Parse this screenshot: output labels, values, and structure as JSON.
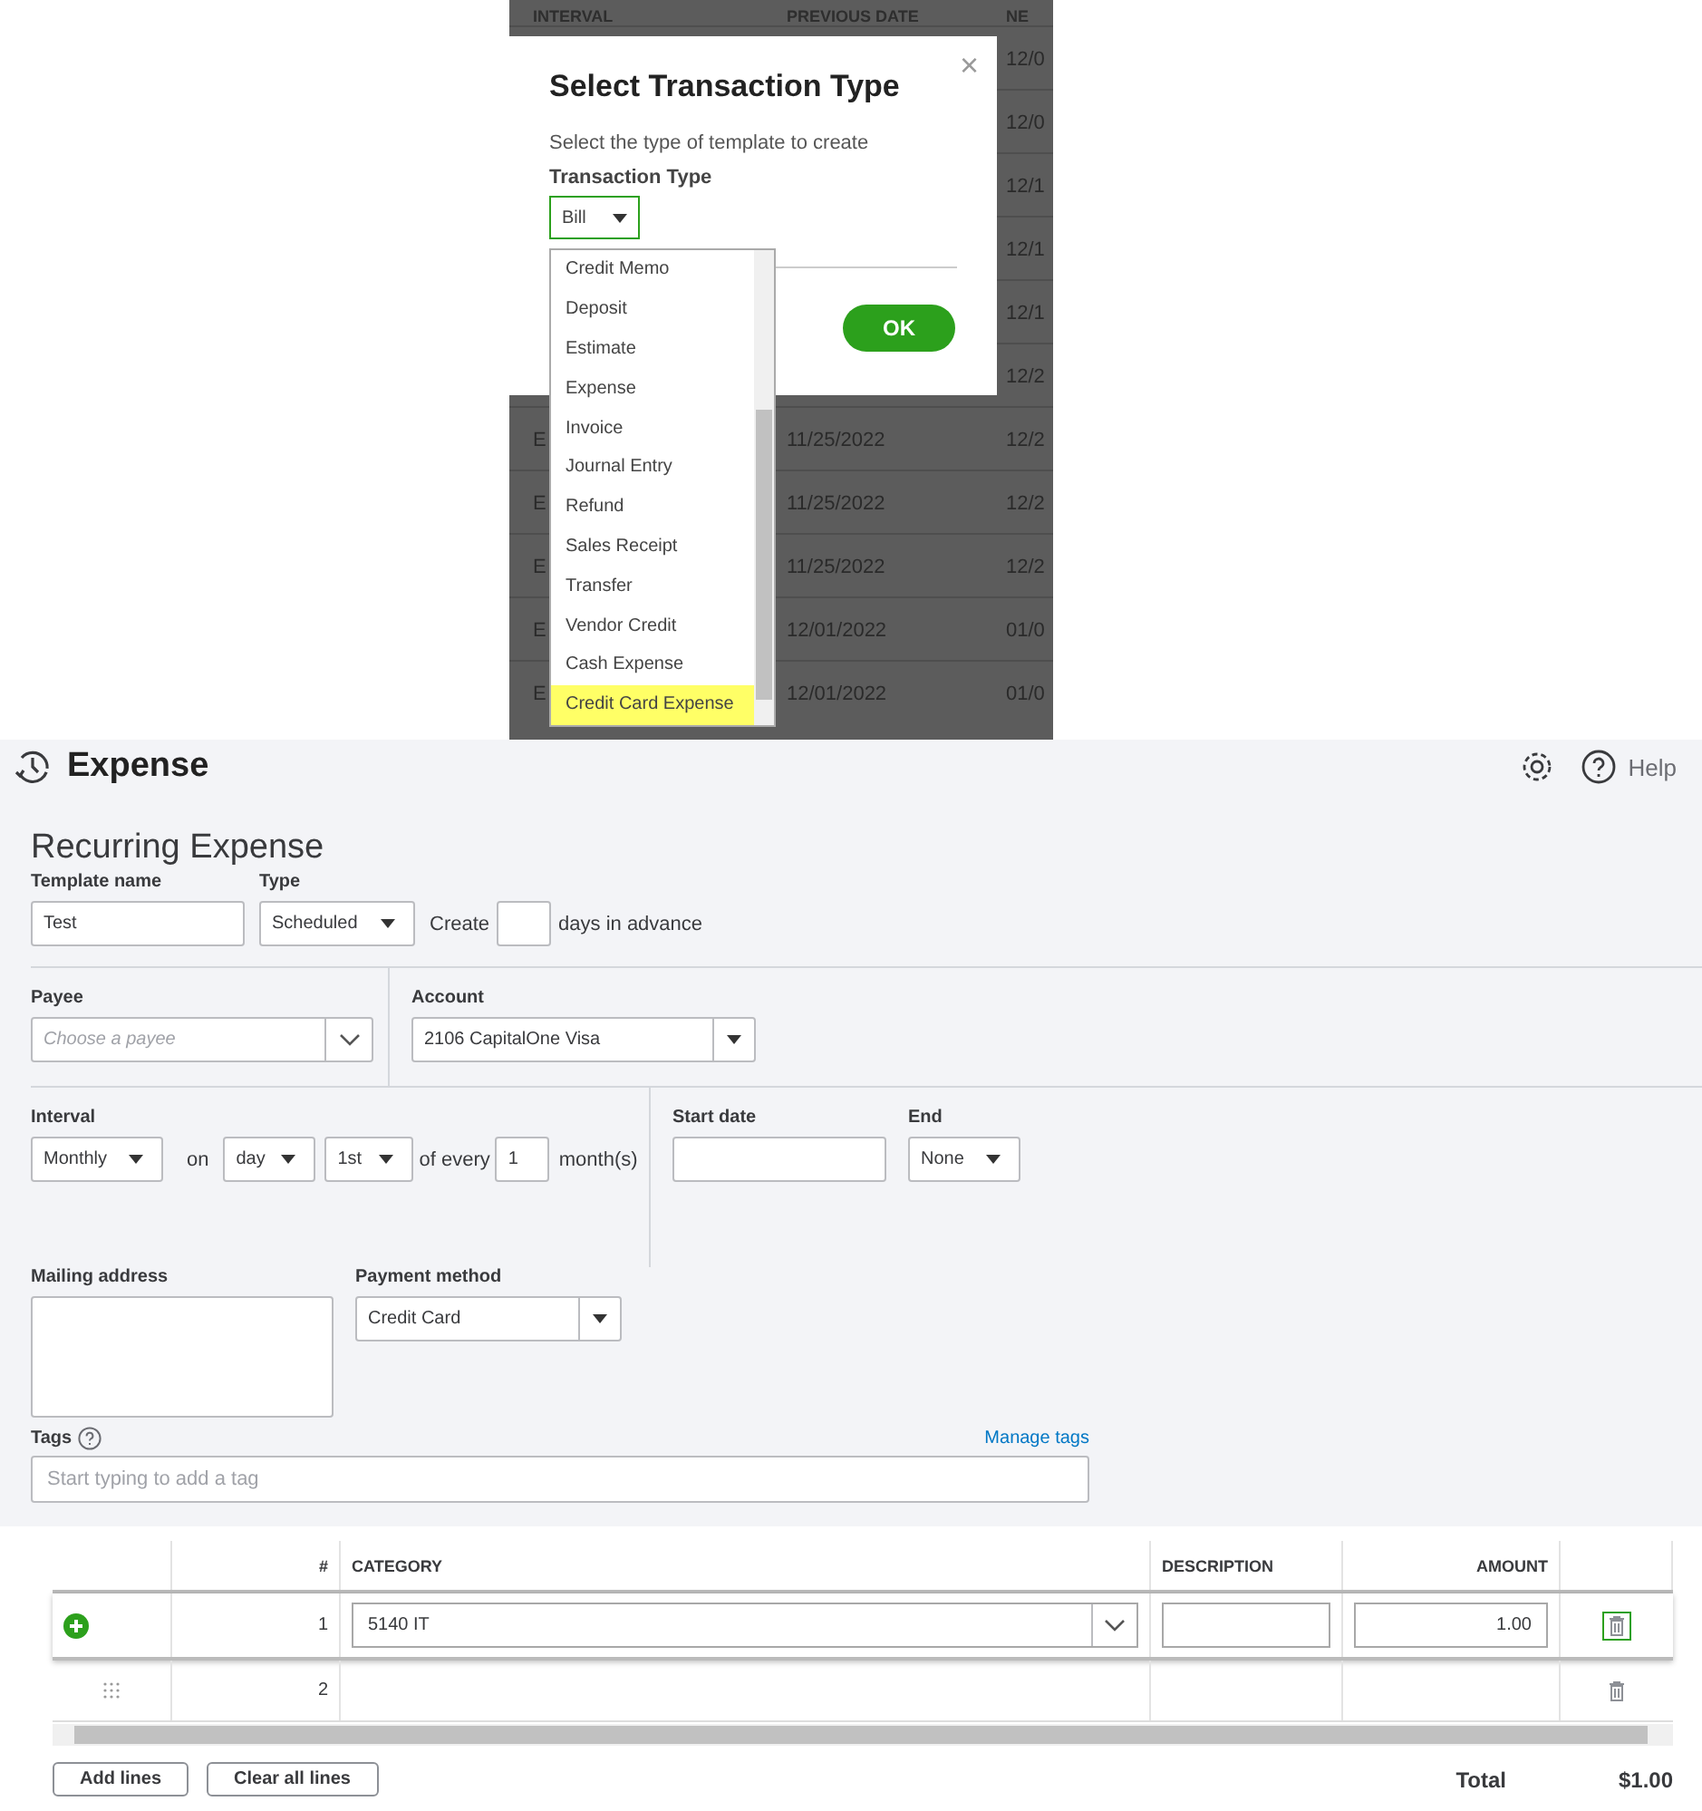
{
  "background_table": {
    "columns": [
      "INTERVAL",
      "PREVIOUS DATE",
      "NE"
    ],
    "rows": [
      {
        "column_3": "12/0"
      },
      {
        "column_3": "12/0"
      },
      {
        "column_3": "12/1"
      },
      {
        "column_3": "12/1"
      },
      {
        "column_3": "12/1"
      },
      {
        "column_3": "12/2"
      },
      {
        "column_1": "E",
        "column_2": "11/25/2022",
        "column_3": "12/2"
      },
      {
        "column_1": "E",
        "column_2": "11/25/2022",
        "column_3": "12/2"
      },
      {
        "column_1": "E",
        "column_2": "11/25/2022",
        "column_3": "12/2"
      },
      {
        "column_1": "E",
        "column_2": "12/01/2022",
        "column_3": "01/0"
      },
      {
        "column_1": "E",
        "column_2": "12/01/2022",
        "column_3": "01/0"
      }
    ]
  },
  "modal": {
    "title": "Select Transaction Type",
    "close": "×",
    "subtitle": "Select the type of template to create",
    "field_label": "Transaction Type",
    "select_value": "Bill",
    "ok": "OK"
  },
  "dropdown": {
    "items": [
      {
        "label": "Credit Memo",
        "selected": false
      },
      {
        "label": "Deposit",
        "selected": false
      },
      {
        "label": "Estimate",
        "selected": false
      },
      {
        "label": "Expense",
        "selected": false
      },
      {
        "label": "Invoice",
        "selected": false
      },
      {
        "label": "Journal Entry",
        "selected": false
      },
      {
        "label": "Refund",
        "selected": false
      },
      {
        "label": "Sales Receipt",
        "selected": false
      },
      {
        "label": "Transfer",
        "selected": false
      },
      {
        "label": "Vendor Credit",
        "selected": false
      },
      {
        "label": "Cash Expense",
        "selected": false
      },
      {
        "label": "Credit Card Expense",
        "selected": true
      }
    ]
  },
  "header": {
    "title": "Expense",
    "help": "Help"
  },
  "form": {
    "heading": "Recurring Expense",
    "template_name": {
      "label": "Template name",
      "value": "Test"
    },
    "type": {
      "label": "Type",
      "value": "Scheduled"
    },
    "create": {
      "before": "Create",
      "after": "days in advance"
    },
    "payee": {
      "label": "Payee",
      "placeholder": "Choose a payee"
    },
    "account": {
      "label": "Account",
      "value": "2106 CapitalOne Visa"
    },
    "interval": {
      "label": "Interval",
      "value": "Monthly",
      "on": "on",
      "unit": "day",
      "day": "1st",
      "of_every": "of every",
      "count": "1",
      "months": "month(s)"
    },
    "start_date": {
      "label": "Start date"
    },
    "end": {
      "label": "End",
      "value": "None"
    },
    "mailing_address": {
      "label": "Mailing address"
    },
    "payment_method": {
      "label": "Payment method",
      "value": "Credit Card"
    },
    "tags": {
      "label": "Tags",
      "manage": "Manage tags",
      "placeholder": "Start typing to add a tag"
    }
  },
  "lines": {
    "columns": [
      "#",
      "CATEGORY",
      "DESCRIPTION",
      "AMOUNT"
    ],
    "rows": [
      {
        "number": "1",
        "category": "5140 IT",
        "amount": "1.00",
        "active": true
      },
      {
        "number": "2",
        "active": false
      }
    ]
  },
  "buttons": [
    "Add lines",
    "Clear all lines"
  ],
  "total": {
    "label": "Total",
    "value": "$1.00"
  }
}
